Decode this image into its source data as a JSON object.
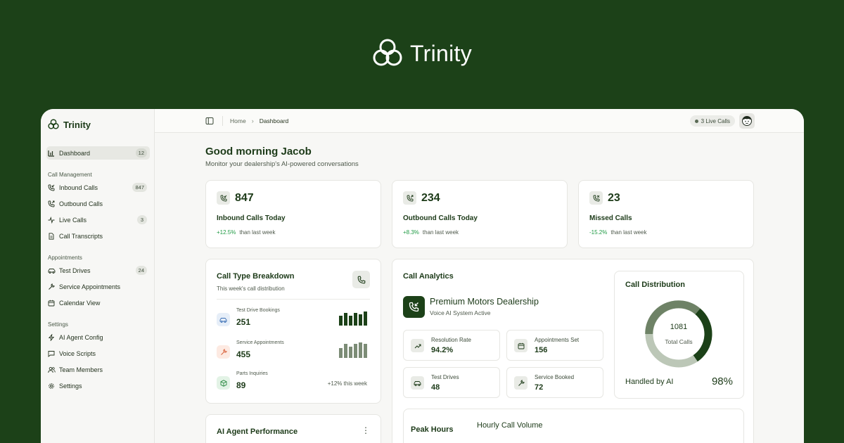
{
  "brand": {
    "name": "Trinity"
  },
  "sidebar": {
    "brand_name": "Trinity",
    "dashboard": {
      "label": "Dashboard",
      "badge": "12"
    },
    "groups": [
      {
        "title": "Call Management",
        "items": [
          {
            "label": "Inbound Calls",
            "icon": "phone-incoming-icon",
            "badge": "847"
          },
          {
            "label": "Outbound Calls",
            "icon": "phone-outgoing-icon",
            "badge": ""
          },
          {
            "label": "Live Calls",
            "icon": "activity-icon",
            "badge": "3"
          },
          {
            "label": "Call Transcripts",
            "icon": "document-icon",
            "badge": ""
          }
        ]
      },
      {
        "title": "Appointments",
        "items": [
          {
            "label": "Test Drives",
            "icon": "car-icon",
            "badge": "24"
          },
          {
            "label": "Service Appointments",
            "icon": "wrench-icon",
            "badge": ""
          },
          {
            "label": "Calendar View",
            "icon": "calendar-icon",
            "badge": ""
          }
        ]
      },
      {
        "title": "Settings",
        "items": [
          {
            "label": "AI Agent Config",
            "icon": "bolt-icon",
            "badge": ""
          },
          {
            "label": "Voice Scripts",
            "icon": "chat-icon",
            "badge": ""
          },
          {
            "label": "Team Members",
            "icon": "users-icon",
            "badge": ""
          },
          {
            "label": "Settings",
            "icon": "gear-icon",
            "badge": ""
          }
        ]
      }
    ]
  },
  "topbar": {
    "breadcrumb": [
      "Home",
      "Dashboard"
    ],
    "live_calls": "3 Live Calls"
  },
  "greeting": {
    "title": "Good morning Jacob",
    "subtitle": "Monitor your dealership's AI-powered conversations"
  },
  "stats": [
    {
      "value": "847",
      "label": "Inbound Calls Today",
      "change": "+12.5%",
      "suffix": "than last week"
    },
    {
      "value": "234",
      "label": "Outbound Calls Today",
      "change": "+8.3%",
      "suffix": "than last week"
    },
    {
      "value": "23",
      "label": "Missed Calls",
      "change": "-15.2%",
      "suffix": "than last week"
    }
  ],
  "call_type": {
    "title": "Call Type Breakdown",
    "subtitle": "This week's call distribution",
    "rows": [
      {
        "label": "Test Drive Bookings",
        "value": "251"
      },
      {
        "label": "Service Appointments",
        "value": "455"
      },
      {
        "label": "Parts Inquiries",
        "value": "89",
        "trend": "+12% this week"
      }
    ]
  },
  "agent_perf": {
    "title": "AI Agent Performance"
  },
  "analytics": {
    "title": "Call Analytics",
    "dealership": "Premium Motors Dealership",
    "status": "Voice AI System Active",
    "metrics": [
      {
        "label": "Resolution Rate",
        "value": "94.2%",
        "icon": "trending-up-icon"
      },
      {
        "label": "Appointments Set",
        "value": "156",
        "icon": "calendar-icon"
      },
      {
        "label": "Test Drives",
        "value": "48",
        "icon": "car-icon"
      },
      {
        "label": "Service Booked",
        "value": "72",
        "icon": "wrench-icon"
      }
    ],
    "peak_hours": "Peak Hours",
    "hourly_volume": "Hourly Call Volume"
  },
  "distribution": {
    "title": "Call Distribution",
    "total": "1081",
    "total_label": "Total Calls",
    "handled_label": "Handled by AI",
    "handled_value": "98%"
  },
  "colors": {
    "brand_dark": "#1c4118",
    "positive": "#1f9a44",
    "negative": "#1f9a44"
  }
}
